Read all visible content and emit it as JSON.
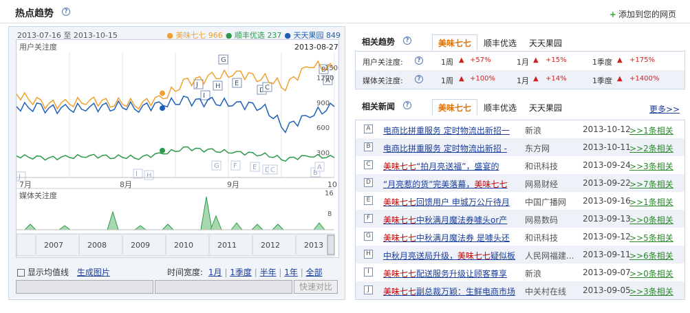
{
  "header": {
    "title": "热点趋势",
    "help": "?",
    "add_label": "添加到您的网页",
    "add_icon": "plus-icon"
  },
  "chart": {
    "date_range": "2013-07-16 至 2013-10-15",
    "legend": [
      {
        "name": "美味七七",
        "value": "966",
        "color": "#f0a030"
      },
      {
        "name": "顺丰优选",
        "value": "237",
        "color": "#2a9a4a"
      },
      {
        "name": "天天果园",
        "value": "849",
        "color": "#1f5fb8"
      }
    ],
    "panel1_label": "用户关注度",
    "panel2_label": "媒体关注度",
    "cursor_date": "2013-08-27",
    "y_ticks": [
      "1200",
      "900",
      "600",
      "300"
    ],
    "y_top_tick": "1500",
    "media_top_tick": "16",
    "media_mid_tick": "8",
    "x_months": [
      "7月",
      "8月",
      "9月",
      "10"
    ],
    "years": [
      "2007",
      "2008",
      "2009",
      "2010",
      "2011",
      "2012",
      "2013"
    ],
    "markers_top": [
      "G",
      "J",
      "H",
      "E",
      "D",
      "C",
      "I",
      "B",
      "A"
    ],
    "markers_low": [
      "J",
      "I",
      "H",
      "G",
      "F",
      "E",
      "D",
      "C",
      "B",
      "A"
    ]
  },
  "chart_data": {
    "type": "line",
    "title": "",
    "ylabel": "用户关注度",
    "ylim": [
      0,
      1500
    ],
    "x": [
      "2013-07-16",
      "2013-07-23",
      "2013-07-30",
      "2013-08-06",
      "2013-08-13",
      "2013-08-20",
      "2013-08-27",
      "2013-09-03",
      "2013-09-10",
      "2013-09-17",
      "2013-09-24",
      "2013-10-01",
      "2013-10-08",
      "2013-10-15"
    ],
    "series": [
      {
        "name": "美味七七",
        "color": "#f0a030",
        "values": [
          1000,
          880,
          880,
          920,
          900,
          880,
          960,
          1150,
          1200,
          1250,
          1200,
          1100,
          1350,
          1300
        ]
      },
      {
        "name": "天天果园",
        "color": "#1f5fb8",
        "values": [
          850,
          830,
          820,
          840,
          860,
          840,
          880,
          920,
          900,
          880,
          860,
          600,
          750,
          849
        ]
      },
      {
        "name": "顺丰优选",
        "color": "#2a9a4a",
        "values": [
          260,
          230,
          240,
          260,
          250,
          240,
          290,
          350,
          320,
          300,
          280,
          220,
          260,
          237
        ]
      }
    ]
  },
  "controls": {
    "avg_label": "显示均值线",
    "gen_label": "生成图片",
    "width_label": "时间宽度:",
    "ranges": [
      "1月",
      "1季度",
      "半年",
      "1年",
      "全部"
    ],
    "compare_label": "快速对比"
  },
  "trend": {
    "title": "相关趋势",
    "tabs": [
      "美味七七",
      "顺丰优选",
      "天天果园"
    ],
    "rows": [
      {
        "label": "用户关注度:",
        "week": "1周",
        "week_val": "+57%",
        "month": "1月",
        "month_val": "+15%",
        "quarter": "1季度",
        "quarter_val": "+175%"
      },
      {
        "label": "媒体关注度:",
        "week": "1周",
        "week_val": "+100%",
        "month": "1月",
        "month_val": "+14%",
        "quarter": "1季度",
        "quarter_val": "+1400%"
      }
    ]
  },
  "news": {
    "title": "相关新闻",
    "more": "更多>>",
    "tabs": [
      "美味七七",
      "顺丰优选",
      "天天果园"
    ],
    "items": [
      {
        "letter": "A",
        "pre": "电商比拼重服务 定时物流出新招一",
        "hl": "",
        "post": "",
        "source": "新浪",
        "date": "2013-10-12",
        "rel": ">>1条相关"
      },
      {
        "letter": "B",
        "pre": "电商比拼重服务 定时物流出新招 -",
        "hl": "",
        "post": "",
        "source": "东方网",
        "date": "2013-10-11",
        "rel": ">>2条相关"
      },
      {
        "letter": "C",
        "pre": "",
        "hl": "美味七七",
        "post": "“拍月亮送福”，盛宴的",
        "source": "和讯科技",
        "date": "2013-09-24",
        "rel": ">>3条相关"
      },
      {
        "letter": "D",
        "pre": "“月亮惹的货”完美落幕，",
        "hl": "美味七七",
        "post": "",
        "source": "网易财经",
        "date": "2013-09-22",
        "rel": ">>7条相关"
      },
      {
        "letter": "E",
        "pre": "",
        "hl": "美味七七",
        "post": "回馈用户 申城万公斤待月",
        "source": "中国广播网",
        "date": "2013-09-16",
        "rel": ">>1条相关"
      },
      {
        "letter": "F",
        "pre": "",
        "hl": "美味七七",
        "post": "中秋满月魔法券噱头or产",
        "source": "网易数码",
        "date": "2013-09-13",
        "rel": ">>0条相关"
      },
      {
        "letter": "G",
        "pre": "",
        "hl": "美味七七",
        "post": "中秋满月魔法券 是噱头还",
        "source": "和讯科技",
        "date": "2013-09-12",
        "rel": ">>5条相关"
      },
      {
        "letter": "H",
        "pre": "中秋月亮送局升级，",
        "hl": "美味七七",
        "post": "疑似板",
        "source": "人民网福建...",
        "date": "2013-09-11",
        "rel": ">>6条相关"
      },
      {
        "letter": "I",
        "pre": "",
        "hl": "美味七七",
        "post": "配送服务升级让顾客尊享",
        "source": "新浪",
        "date": "2013-09-07",
        "rel": ">>0条相关"
      },
      {
        "letter": "J",
        "pre": "",
        "hl": "美味七七",
        "post": "副总裁万颖：生鲜电商市场",
        "source": "中关村在线",
        "date": "2013-09-05",
        "rel": ">>3条相关"
      }
    ]
  }
}
